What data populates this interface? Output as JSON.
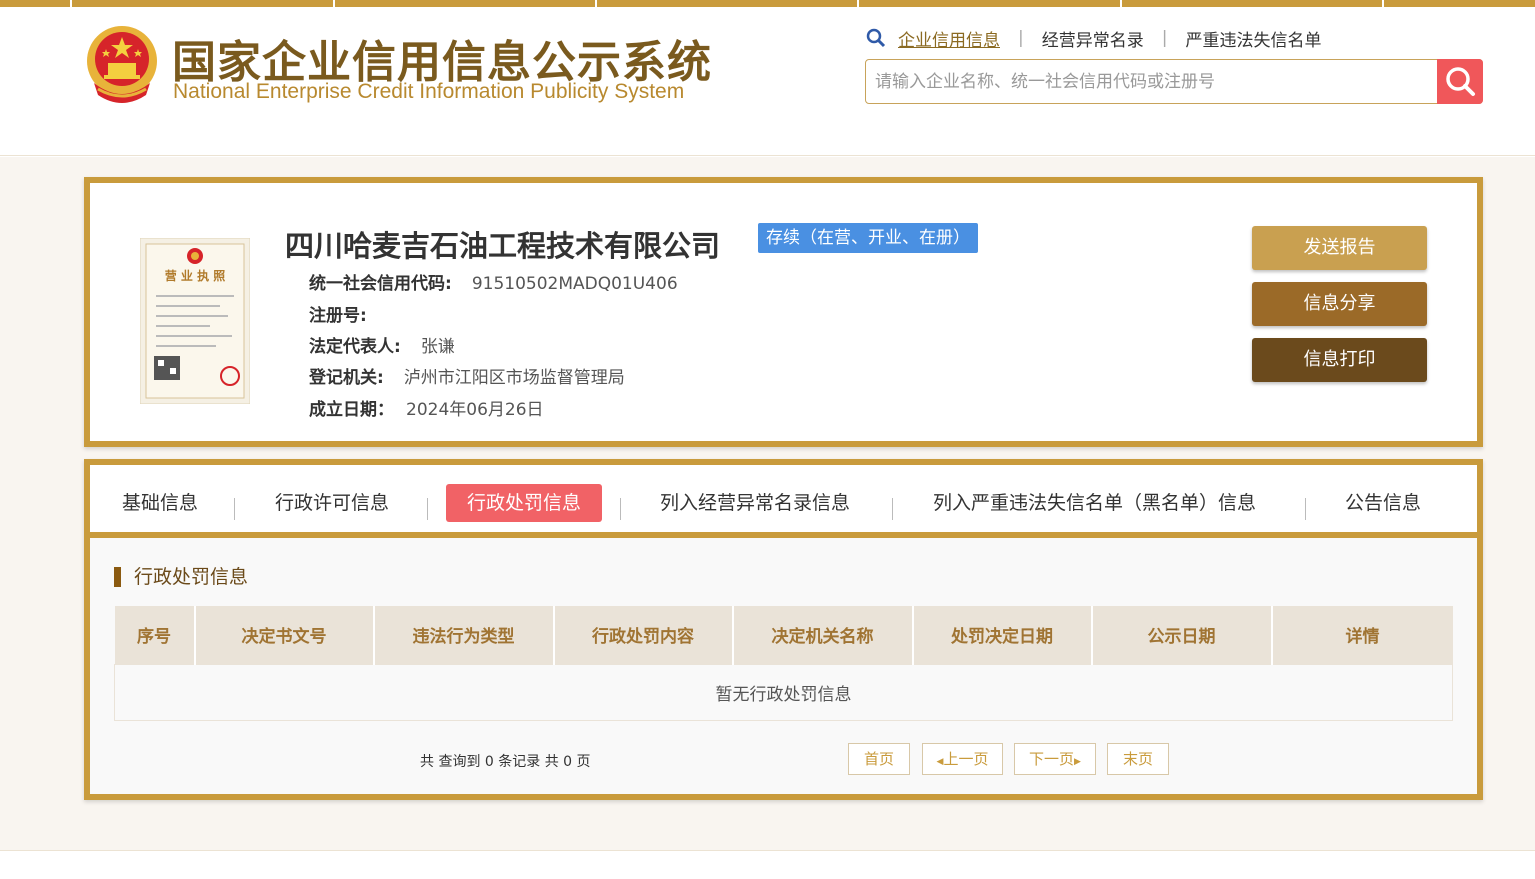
{
  "header": {
    "title_cn": "国家企业信用信息公示系统",
    "title_en": "National Enterprise Credit Information Publicity System",
    "nav": [
      "企业信用信息",
      "经营异常名录",
      "严重违法失信名单"
    ],
    "search_placeholder": "请输入企业名称、统一社会信用代码或注册号"
  },
  "company": {
    "name": "四川哈麦吉石油工程技术有限公司",
    "status": "存续（在营、开业、在册）",
    "fields": [
      {
        "label": "统一社会信用代码:",
        "value": "91510502MADQ01U406"
      },
      {
        "label": "注册号:",
        "value": ""
      },
      {
        "label": "法定代表人:",
        "value": "张谦"
      },
      {
        "label": "登记机关:",
        "value": "泸州市江阳区市场监督管理局"
      },
      {
        "label": "成立日期：",
        "value": "2024年06月26日"
      }
    ],
    "license_title": "营 业 执 照"
  },
  "actions": [
    "发送报告",
    "信息分享",
    "信息打印"
  ],
  "tabs": [
    "基础信息",
    "行政许可信息",
    "行政处罚信息",
    "列入经营异常名录信息",
    "列入严重违法失信名单（黑名单）信息",
    "公告信息"
  ],
  "section": {
    "title": "行政处罚信息",
    "columns": [
      "序号",
      "决定书文号",
      "违法行为类型",
      "行政处罚内容",
      "决定机关名称",
      "处罚决定日期",
      "公示日期",
      "详情"
    ],
    "empty_text": "暂无行政处罚信息"
  },
  "pagination": {
    "summary": "共 查询到 0 条记录 共 0 页",
    "first": "首页",
    "prev": "上一页",
    "next": "下一页",
    "last": "末页"
  },
  "colors": {
    "gold": "#c99b3c",
    "active_tab": "#f16266",
    "status_blue": "#4a90e2",
    "btn_send": "#c9a050",
    "btn_share": "#9b6a28",
    "btn_print": "#6b4a1c"
  }
}
